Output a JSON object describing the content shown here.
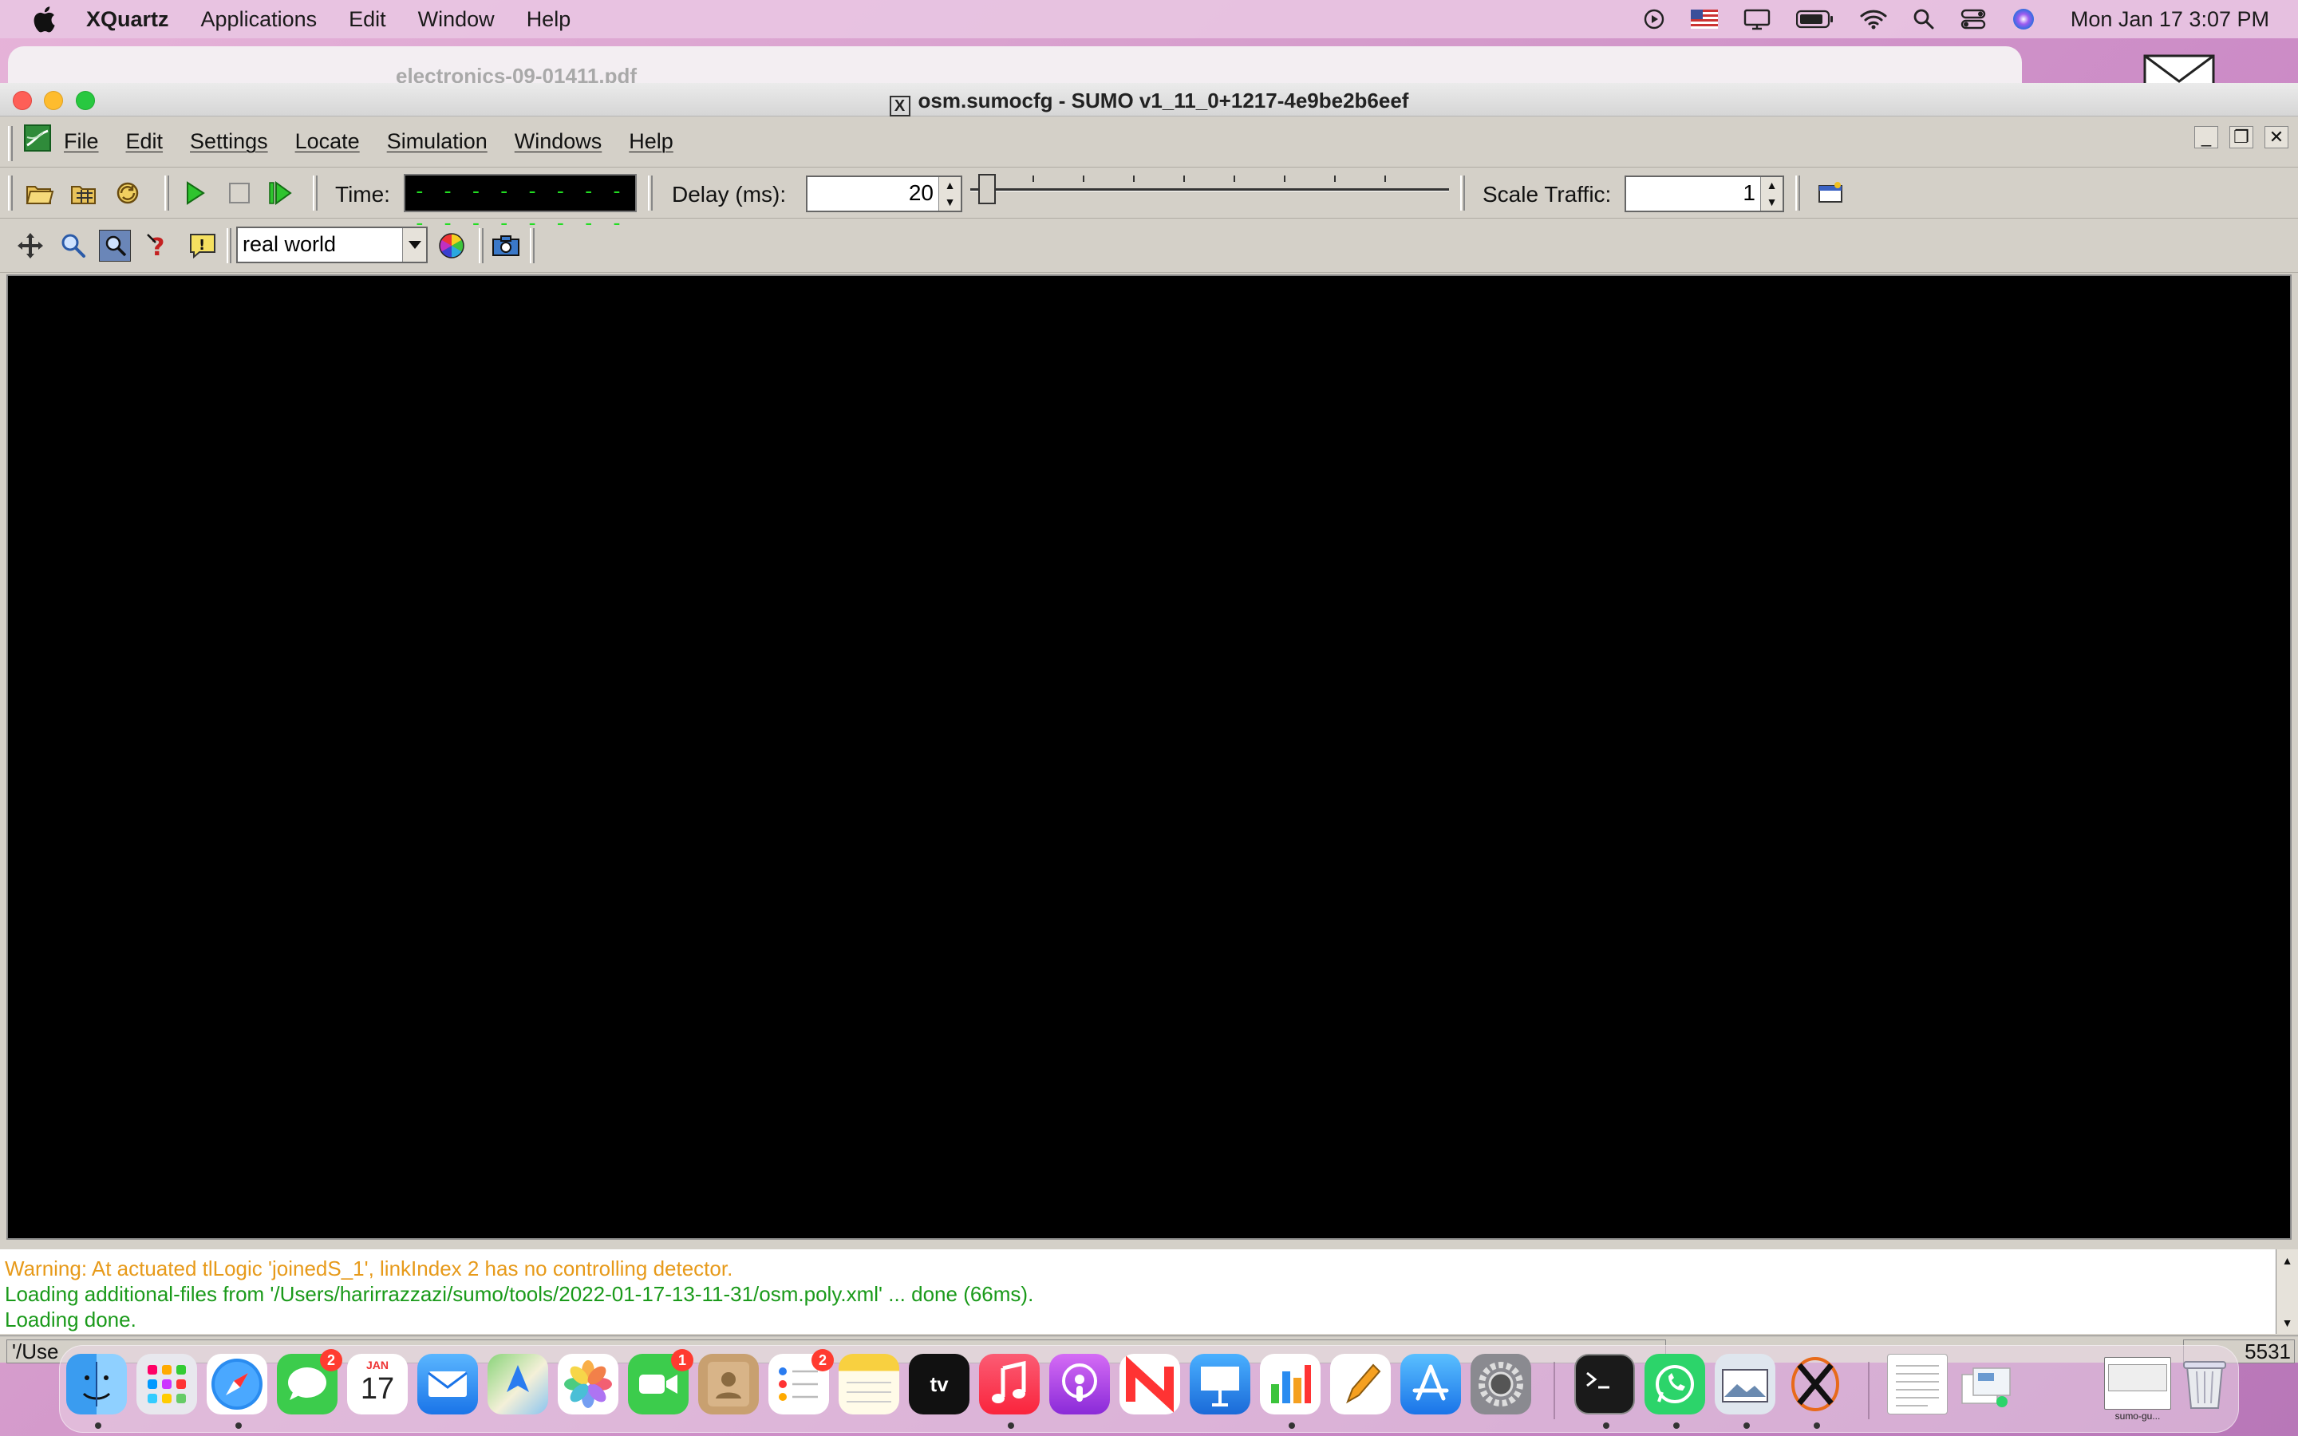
{
  "macos_menubar": {
    "app_name": "XQuartz",
    "items": [
      "Applications",
      "Edit",
      "Window",
      "Help"
    ],
    "clock": "Mon Jan 17  3:07 PM"
  },
  "background_window": {
    "title": "electronics-09-01411.pdf"
  },
  "sumo_window": {
    "title": "osm.sumocfg - SUMO v1_11_0+1217-4e9be2b6eef",
    "menu": [
      "File",
      "Edit",
      "Settings",
      "Locate",
      "Simulation",
      "Windows",
      "Help"
    ],
    "toolbar": {
      "time_label": "Time:",
      "time_value": "- - - - - - - - - - - - - - - -",
      "delay_label": "Delay (ms):",
      "delay_value": "20",
      "scale_label": "Scale Traffic:",
      "scale_value": "1"
    },
    "view_toolbar": {
      "scheme_value": "real world"
    },
    "messages": [
      "Warning: At actuated tlLogic 'joinedS_1', linkIndex 2 has no controlling detector.",
      "Loading additional-files from '/Users/harirrazzazi/sumo/tools/2022-01-17-13-11-31/osm.poly.xml' ... done (66ms).",
      "Loading done."
    ],
    "status_left": "'/Use",
    "status_right": "5531"
  },
  "dock": {
    "calendar_month": "JAN",
    "calendar_day": "17",
    "messages_badge": "2",
    "facetime_badge": "1",
    "reminders_badge": "2",
    "tv_label": "tv",
    "thumbnail_label": "sumo-gu..."
  },
  "colors": {
    "warning": "#e79a1a",
    "success": "#1a9a1a",
    "time_display": "#22dd22"
  }
}
